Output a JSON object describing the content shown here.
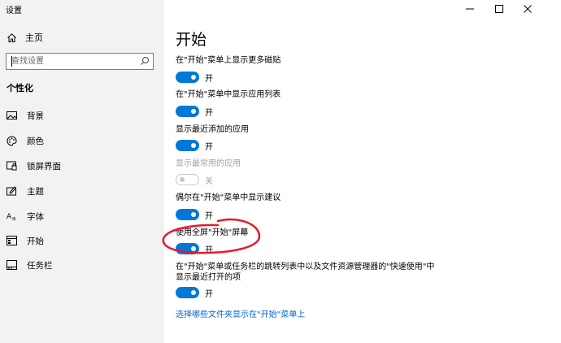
{
  "window": {
    "title": "设置"
  },
  "sidebar": {
    "home_label": "主页",
    "search_placeholder": "查找设置",
    "section_title": "个性化",
    "items": [
      {
        "label": "背景",
        "icon": "image-icon"
      },
      {
        "label": "颜色",
        "icon": "palette-icon"
      },
      {
        "label": "锁屏界面",
        "icon": "lockscreen-icon"
      },
      {
        "label": "主题",
        "icon": "theme-icon"
      },
      {
        "label": "字体",
        "icon": "font-icon"
      },
      {
        "label": "开始",
        "icon": "start-icon"
      },
      {
        "label": "任务栏",
        "icon": "taskbar-icon"
      }
    ]
  },
  "main": {
    "title": "开始",
    "settings": [
      {
        "label": "在\"开始\"菜单上显示更多磁贴",
        "state": "开",
        "on": true,
        "disabled": false
      },
      {
        "label": "在\"开始\"菜单中显示应用列表",
        "state": "开",
        "on": true,
        "disabled": false
      },
      {
        "label": "显示最近添加的应用",
        "state": "开",
        "on": true,
        "disabled": false
      },
      {
        "label": "显示最常用的应用",
        "state": "关",
        "on": false,
        "disabled": true
      },
      {
        "label": "偶尔在\"开始\"菜单中显示建议",
        "state": "开",
        "on": true,
        "disabled": false
      },
      {
        "label": "使用全屏\"开始\"屏幕",
        "state": "开",
        "on": true,
        "disabled": false
      },
      {
        "label_line1": "在\"开始\"菜单或任务栏的跳转列表中以及文件资源管理器的\"快速使用\"中",
        "label_line2": "显示最近打开的项",
        "state": "开",
        "on": true,
        "disabled": false
      }
    ],
    "link": "选择哪些文件夹显示在\"开始\"菜单上"
  },
  "colors": {
    "accent": "#0078d7",
    "sidebar_bg": "#f2f2f2",
    "annotation": "#e8192c"
  }
}
